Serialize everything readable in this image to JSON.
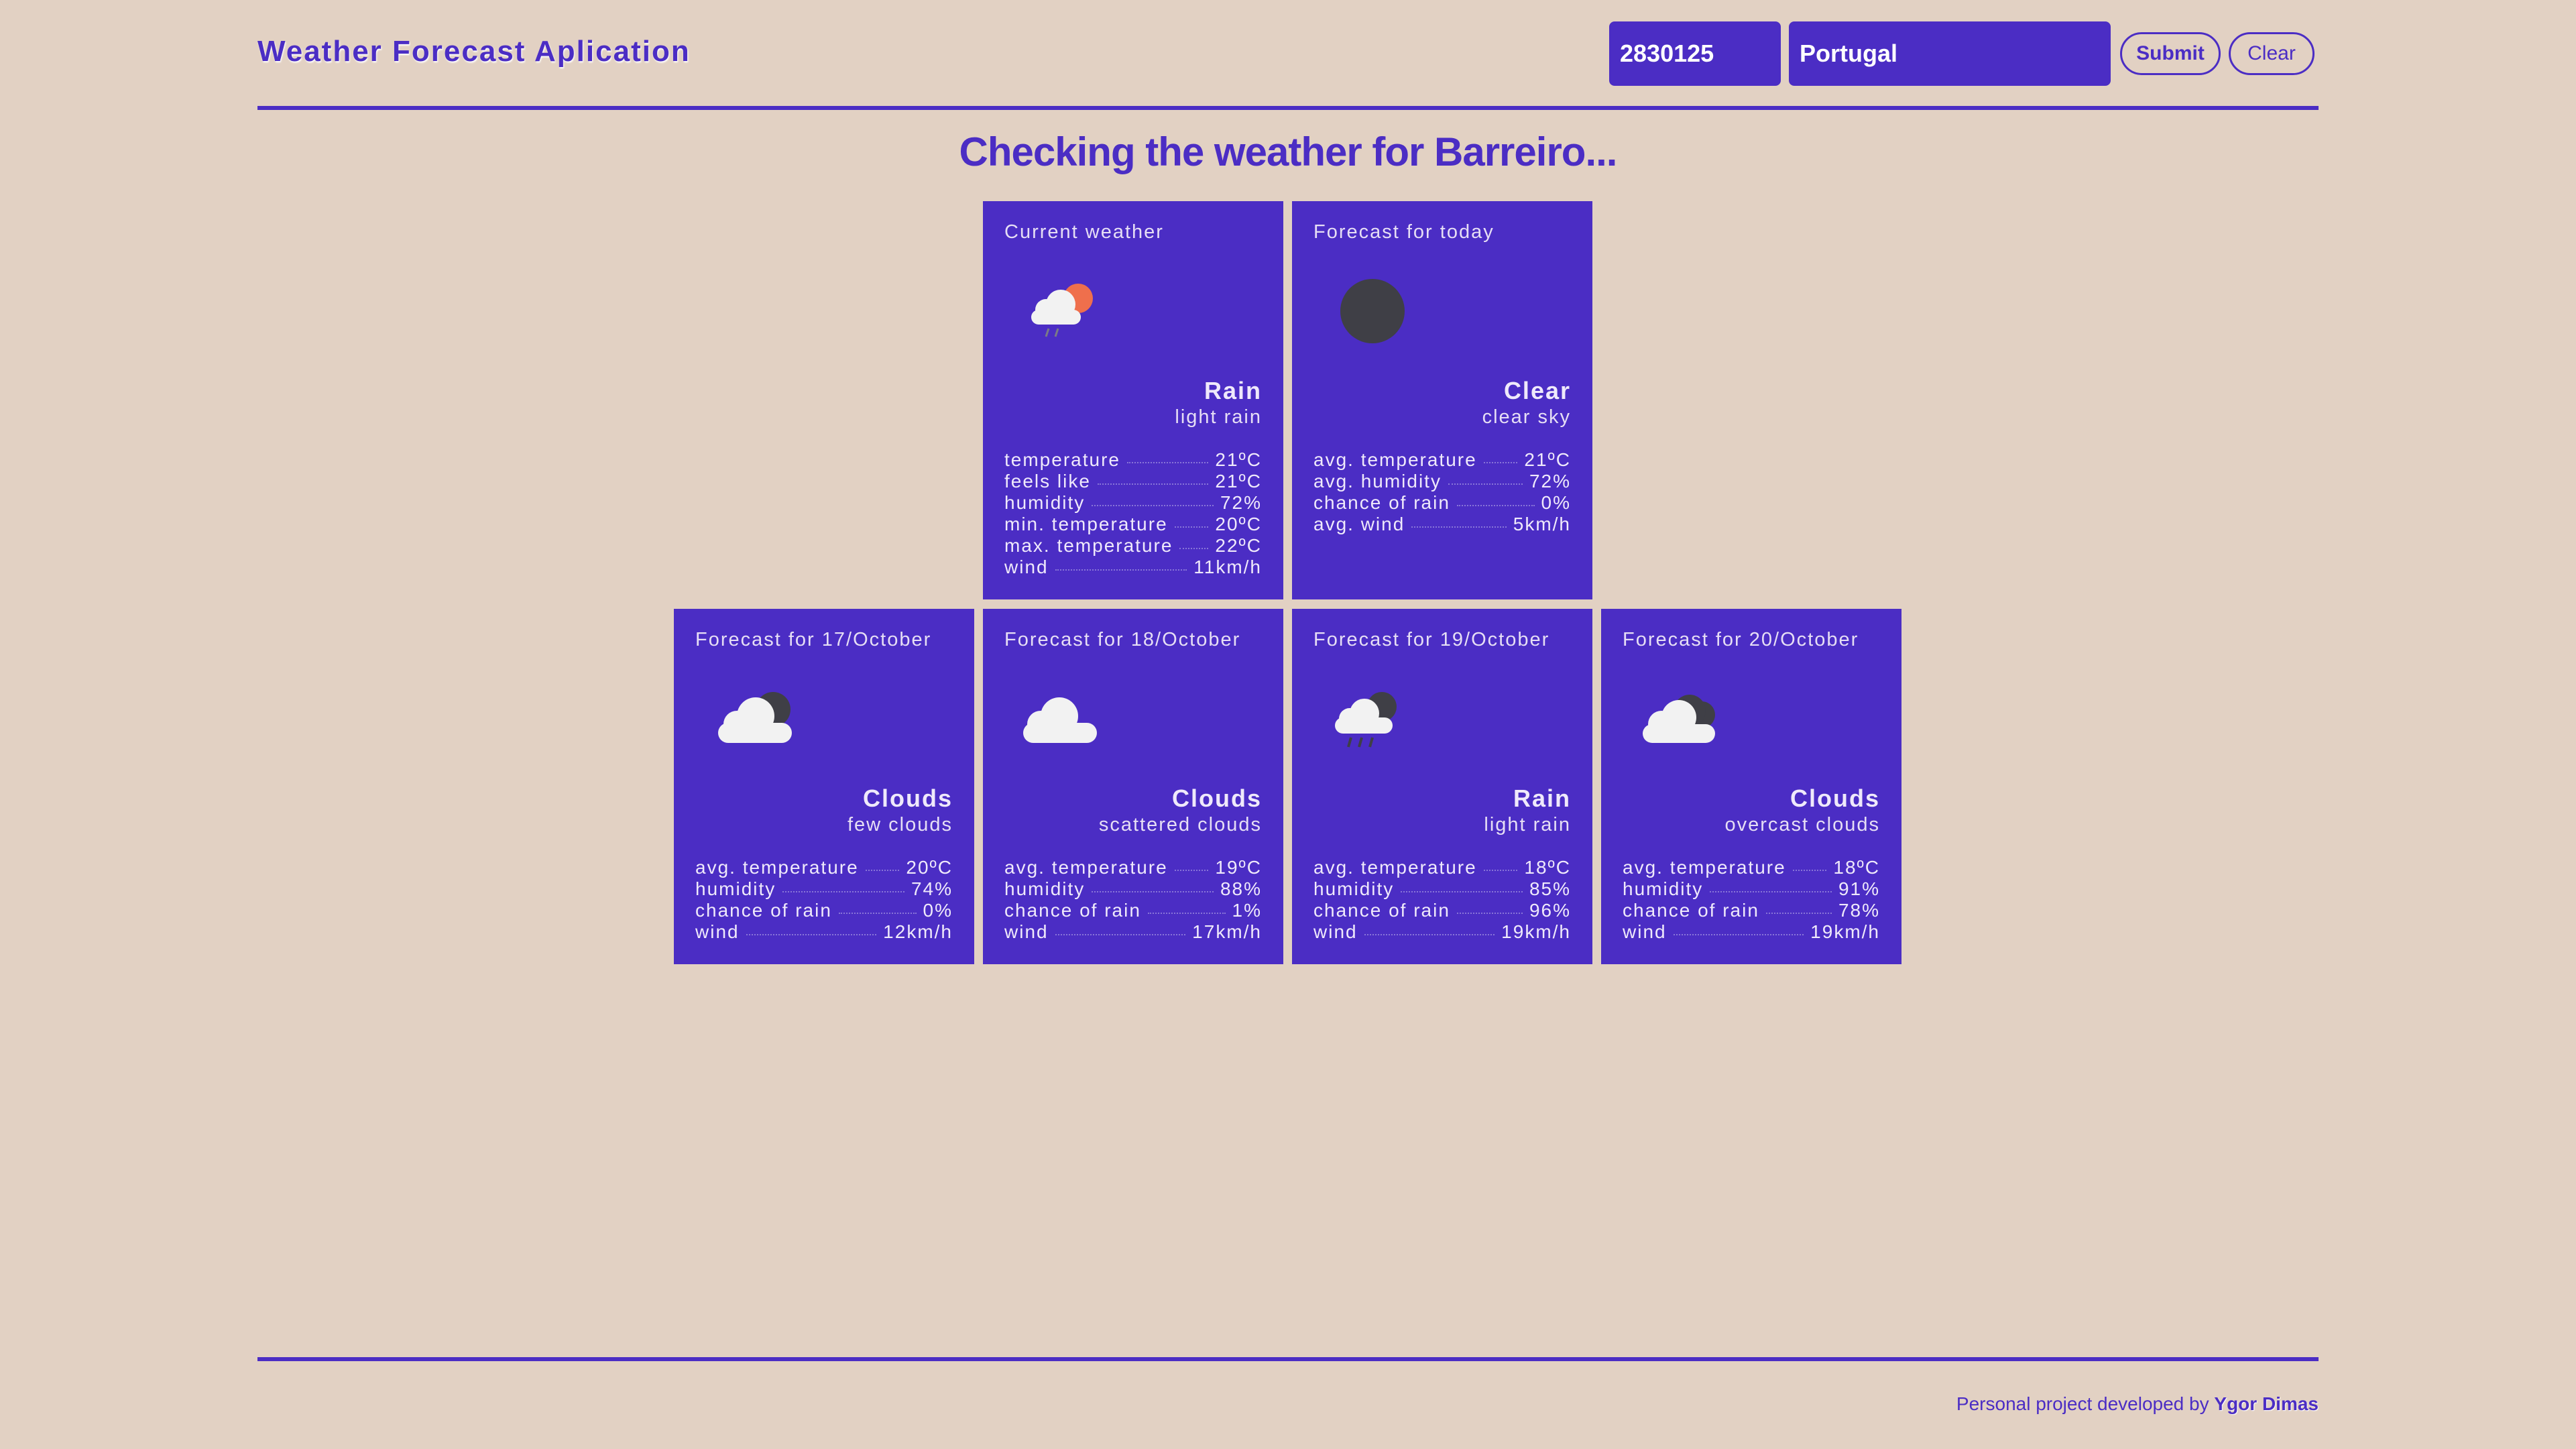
{
  "header": {
    "title": "Weather Forecast Aplication",
    "zip_value": "2830125",
    "country_value": "Portugal",
    "submit_label": "Submit",
    "clear_label": "Clear"
  },
  "headline": "Checking the weather for Barreiro...",
  "colors": {
    "background": "#e2d1c3",
    "accent": "#4b2dc4",
    "sun": "#ef6f4c",
    "night": "#3f3f46",
    "cloud": "#f2f2f2"
  },
  "current": {
    "title": "Current weather",
    "icon": "rain-sun-icon",
    "main": "Rain",
    "desc": "light rain",
    "stats": [
      {
        "label": "temperature",
        "value": "21ºC"
      },
      {
        "label": "feels like",
        "value": "21ºC"
      },
      {
        "label": "humidity",
        "value": "72%"
      },
      {
        "label": "min. temperature",
        "value": "20ºC"
      },
      {
        "label": "max. temperature",
        "value": "22ºC"
      },
      {
        "label": "wind",
        "value": "11km/h"
      }
    ]
  },
  "today": {
    "title": "Forecast for today",
    "icon": "moon-icon",
    "main": "Clear",
    "desc": "clear sky",
    "stats": [
      {
        "label": "avg. temperature",
        "value": "21ºC"
      },
      {
        "label": "avg. humidity",
        "value": "72%"
      },
      {
        "label": "chance of rain",
        "value": "0%"
      },
      {
        "label": "avg. wind",
        "value": "5km/h"
      }
    ]
  },
  "forecast": [
    {
      "title": "Forecast for 17/October",
      "icon": "cloud-moon-icon",
      "main": "Clouds",
      "desc": "few clouds",
      "stats": [
        {
          "label": "avg. temperature",
          "value": "20ºC"
        },
        {
          "label": "humidity",
          "value": "74%"
        },
        {
          "label": "chance of rain",
          "value": "0%"
        },
        {
          "label": "wind",
          "value": "12km/h"
        }
      ]
    },
    {
      "title": "Forecast for 18/October",
      "icon": "cloud-icon",
      "main": "Clouds",
      "desc": "scattered clouds",
      "stats": [
        {
          "label": "avg. temperature",
          "value": "19ºC"
        },
        {
          "label": "humidity",
          "value": "88%"
        },
        {
          "label": "chance of rain",
          "value": "1%"
        },
        {
          "label": "wind",
          "value": "17km/h"
        }
      ]
    },
    {
      "title": "Forecast for 19/October",
      "icon": "rain-moon-icon",
      "main": "Rain",
      "desc": "light rain",
      "stats": [
        {
          "label": "avg. temperature",
          "value": "18ºC"
        },
        {
          "label": "humidity",
          "value": "85%"
        },
        {
          "label": "chance of rain",
          "value": "96%"
        },
        {
          "label": "wind",
          "value": "19km/h"
        }
      ]
    },
    {
      "title": "Forecast for 20/October",
      "icon": "overcast-clouds-icon",
      "main": "Clouds",
      "desc": "overcast clouds",
      "stats": [
        {
          "label": "avg. temperature",
          "value": "18ºC"
        },
        {
          "label": "humidity",
          "value": "91%"
        },
        {
          "label": "chance of rain",
          "value": "78%"
        },
        {
          "label": "wind",
          "value": "19km/h"
        }
      ]
    }
  ],
  "footer": {
    "text": "Personal project developed by",
    "author": "Ygor Dimas"
  }
}
